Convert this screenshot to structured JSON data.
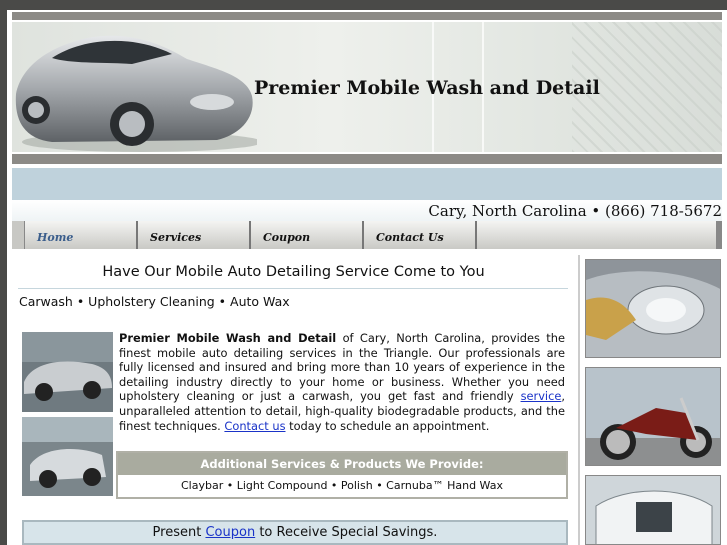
{
  "site": {
    "title": "Premier Mobile Wash and Detail"
  },
  "contact": {
    "line": "Cary, North Carolina • (866) 718-5672"
  },
  "nav": {
    "items": [
      {
        "label": "Home"
      },
      {
        "label": "Services"
      },
      {
        "label": "Coupon"
      },
      {
        "label": "Contact Us"
      }
    ]
  },
  "main": {
    "headline": "Have Our Mobile Auto Detailing Service Come to You",
    "subline": "Carwash • Upholstery Cleaning • Auto Wax",
    "para": {
      "bold": "Premier Mobile Wash and Detail",
      "t1": " of Cary, North Carolina, provides the finest mobile auto detailing services in the Triangle. Our professionals are fully licensed and insured and bring more than 10 years of experience in the detailing industry directly to your home or business. Whether you need upholstery cleaning or just a carwash, you get fast and friendly ",
      "link1": "service",
      "t2": ", unparalleled attention to detail, high-quality biodegradable products, and the finest techniques. ",
      "link2": "Contact us",
      "t3": " today to schedule an appointment."
    },
    "additional": {
      "heading": "Additional Services & Products We Provide:",
      "items": "Claybar • Light Compound • Polish • Carnuba™ Hand Wax"
    },
    "coupon": {
      "before": "Present ",
      "link": "Coupon",
      "after": " to Receive Special Savings."
    }
  },
  "colors": {
    "nav_active": "#3b5e8c",
    "link": "#1a33c8",
    "sky_band": "#bfd2dc",
    "panel_header": "#a9ab9f"
  }
}
